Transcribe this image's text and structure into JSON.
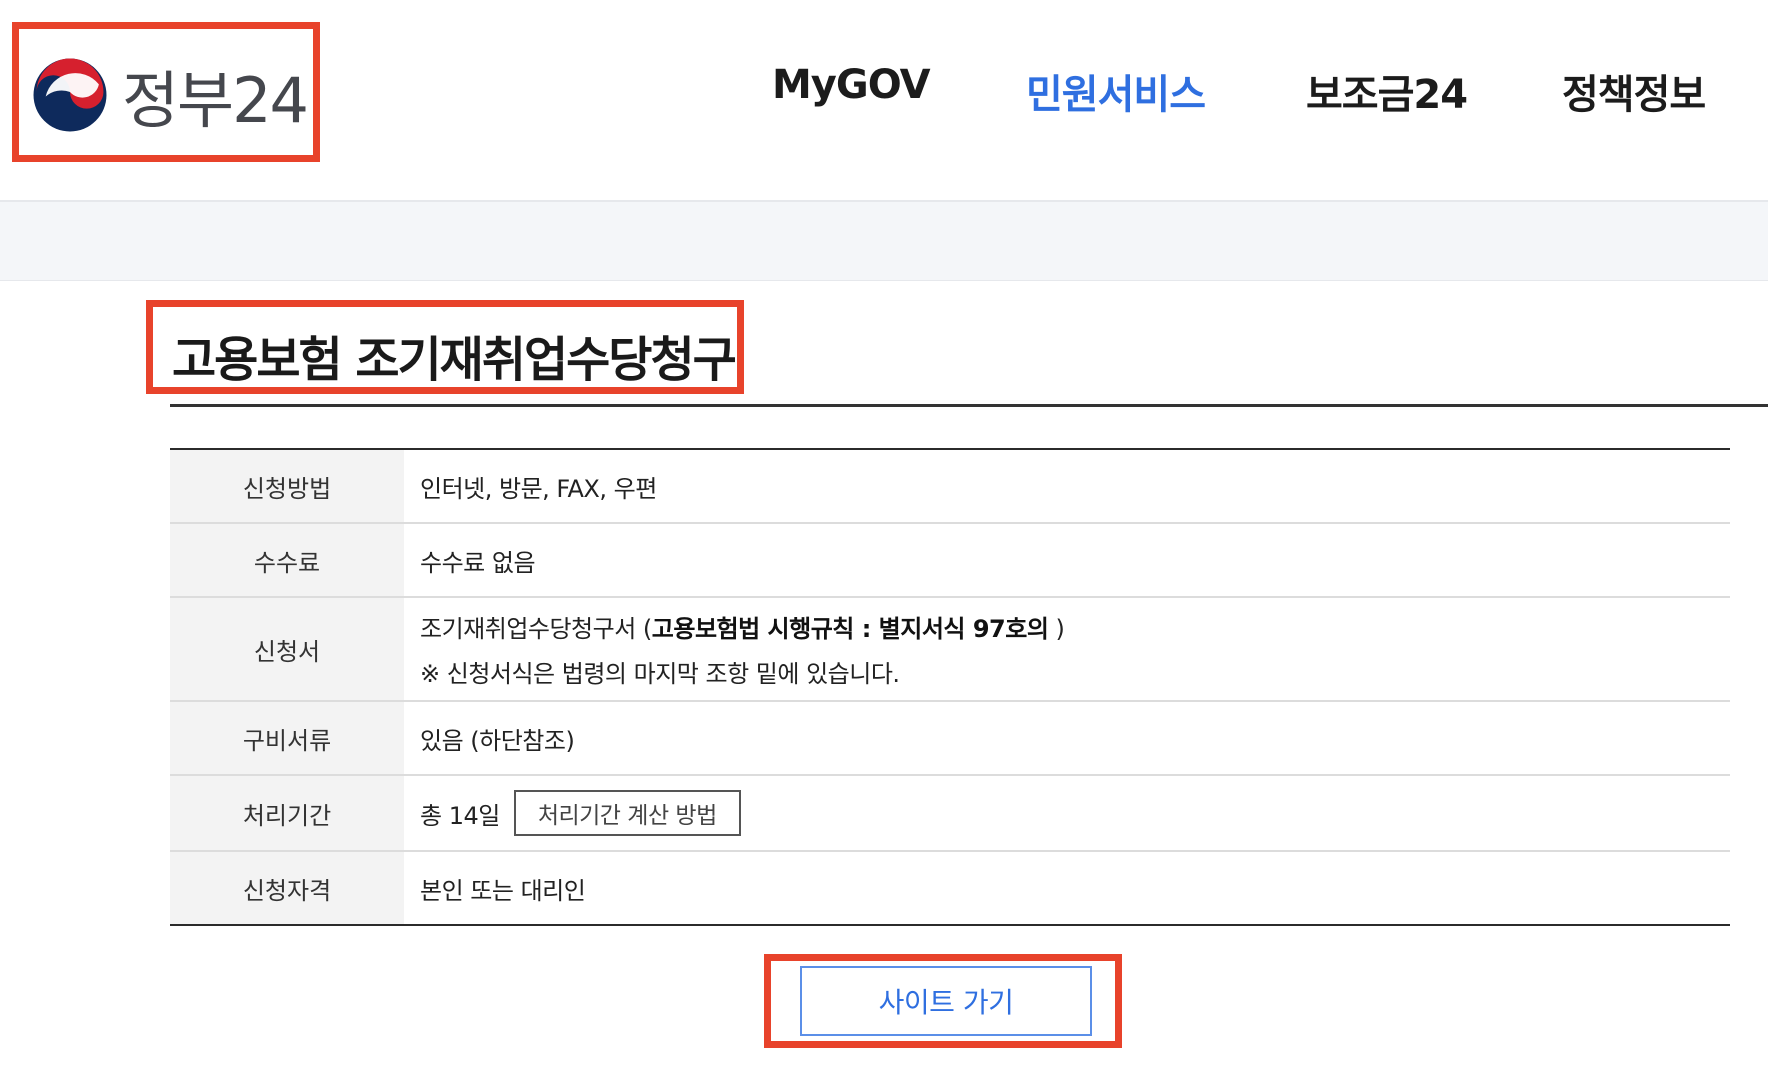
{
  "header": {
    "logo_text": "정부24",
    "logo_icon": "taegeuk-emblem-icon",
    "nav": [
      {
        "label": "MyGOV",
        "active": false
      },
      {
        "label": "민원서비스",
        "active": true
      },
      {
        "label": "보조금24",
        "active": false
      },
      {
        "label": "정책정보",
        "active": false
      }
    ]
  },
  "page_title": "고용보험 조기재취업수당청구",
  "info_table": {
    "rows": [
      {
        "label": "신청방법",
        "value": "인터넷, 방문, FAX, 우편"
      },
      {
        "label": "수수료",
        "value": "수수료 없음"
      },
      {
        "label": "신청서",
        "value_prefix": "조기재취업수당청구서 (",
        "value_bold": "고용보험법 시행규칙 : 별지서식 97호의",
        "value_suffix": " )",
        "note": "※ 신청서식은 법령의 마지막 조항 밑에 있습니다."
      },
      {
        "label": "구비서류",
        "value": "있음 (하단참조)"
      },
      {
        "label": "처리기간",
        "value": "총 14일",
        "button": "처리기간 계산 방법"
      },
      {
        "label": "신청자격",
        "value": "본인 또는 대리인"
      }
    ]
  },
  "site_button": "사이트 가기",
  "colors": {
    "accent": "#2f6fe0",
    "highlight_box": "#e8432b",
    "band": "#f4f6f9"
  }
}
